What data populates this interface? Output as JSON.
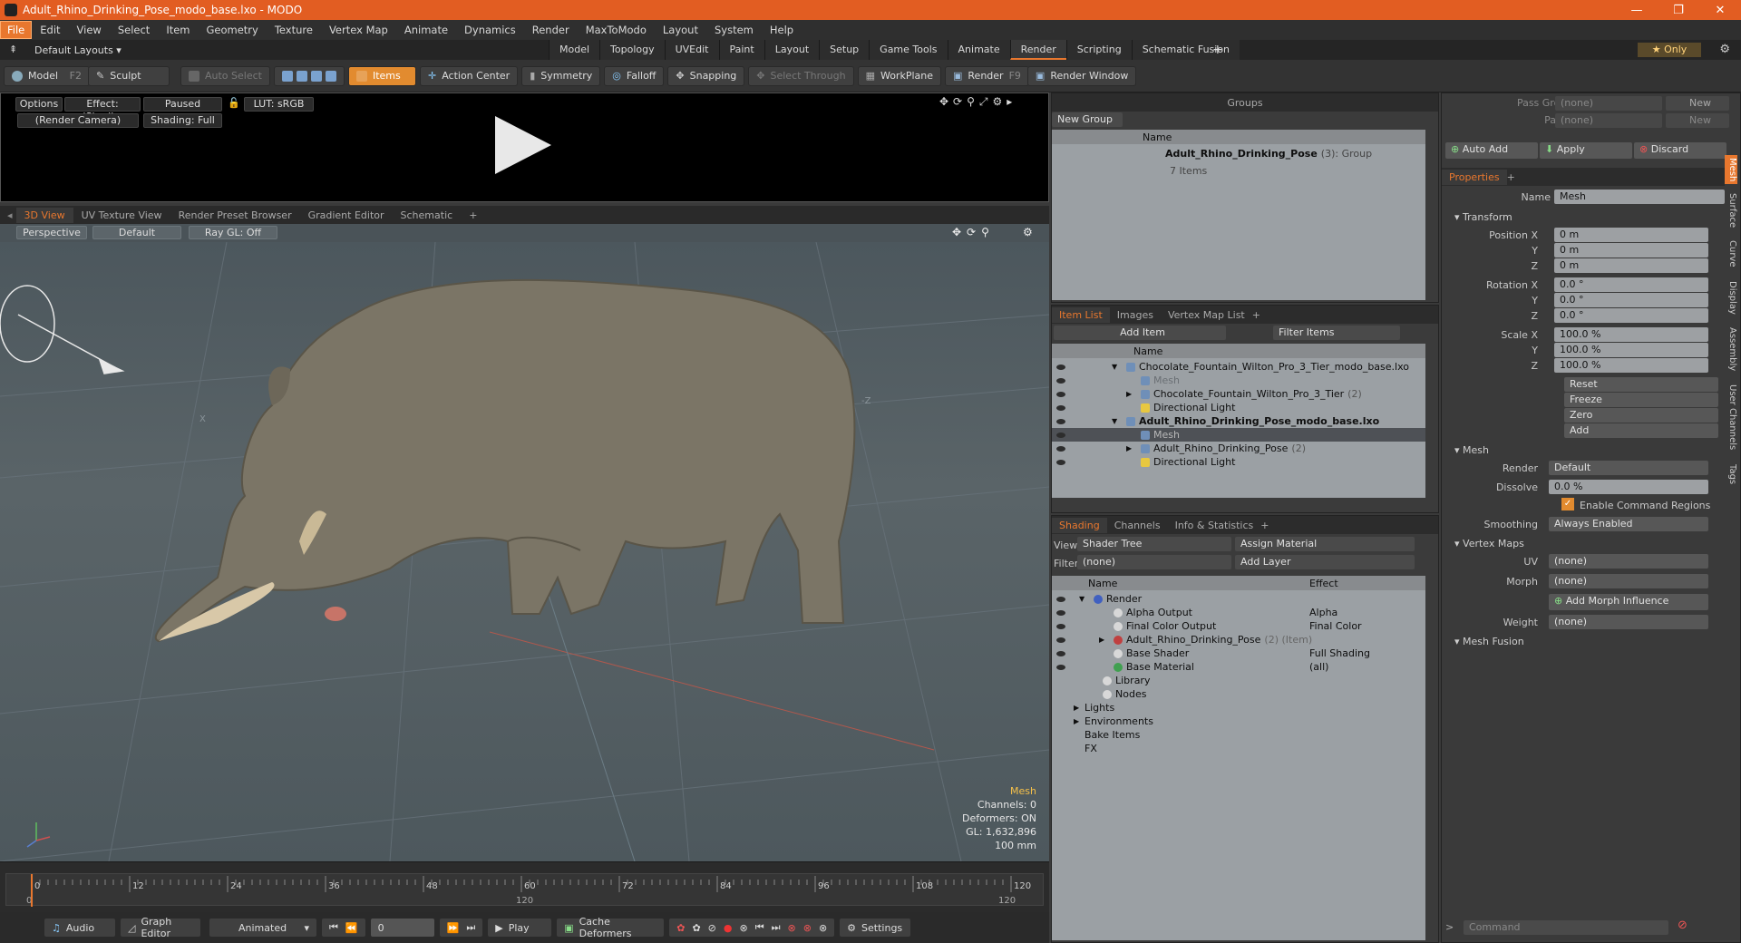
{
  "window": {
    "title": "Adult_Rhino_Drinking_Pose_modo_base.lxo - MODO",
    "min": "—",
    "max": "❐",
    "close": "✕"
  },
  "menu": [
    "File",
    "Edit",
    "View",
    "Select",
    "Item",
    "Geometry",
    "Texture",
    "Vertex Map",
    "Animate",
    "Dynamics",
    "Render",
    "MaxToModo",
    "Layout",
    "System",
    "Help"
  ],
  "layouts": {
    "default": "Default Layouts ▾",
    "tabs": [
      "Model",
      "Topology",
      "UVEdit",
      "Paint",
      "Layout",
      "Setup",
      "Game Tools",
      "Animate",
      "Render",
      "Scripting",
      "Schematic Fusion"
    ],
    "active": "Render",
    "add": "+",
    "only": "★  Only"
  },
  "toolbar": {
    "model": "Model",
    "model_key": "F2",
    "sculpt": "Sculpt",
    "auto_select": "Auto Select",
    "items": "Items",
    "action_center": "Action Center",
    "symmetry": "Symmetry",
    "falloff": "Falloff",
    "snapping": "Snapping",
    "select_through": "Select Through",
    "workplane": "WorkPlane",
    "render": "Render",
    "render_key": "F9",
    "render_window": "Render Window"
  },
  "preview": {
    "options": "Options",
    "effect": "Effect: (Shadi...",
    "paused": "Paused",
    "lut": "LUT: sRGB",
    "camera": "(Render Camera)",
    "shading": "Shading: Full"
  },
  "viewtabs": {
    "tabs": [
      "3D View",
      "UV Texture View",
      "Render Preset Browser",
      "Gradient Editor",
      "Schematic"
    ],
    "add": "+"
  },
  "viewbar": {
    "perspective": "Perspective",
    "default": "Default",
    "raygl": "Ray GL: Off"
  },
  "viewport_info": {
    "type": "Mesh",
    "channels": "Channels: 0",
    "deformers": "Deformers: ON",
    "gl": "GL: 1,632,896",
    "scale": "100 mm",
    "axis_x": "X",
    "axis_z": "-Z"
  },
  "timeline": {
    "ticks_top": [
      "0",
      "12",
      "24",
      "36",
      "48",
      "60",
      "72",
      "84",
      "96",
      "108",
      "120"
    ],
    "ticks_bottom": [
      "0",
      "120",
      "120"
    ]
  },
  "bottombar": {
    "audio": "Audio",
    "graph": "Graph Editor",
    "animated": "Animated",
    "frame": "0",
    "play": "Play",
    "cache": "Cache Deformers",
    "settings": "Settings"
  },
  "groups": {
    "title": "Groups",
    "new_group": "New Group",
    "col_name": "Name",
    "item_name": "Adult_Rhino_Drinking_Pose",
    "item_count": "(3)",
    "item_type": ": Group",
    "item_sub": "7 Items"
  },
  "itemlist": {
    "tabs": [
      "Item List",
      "Images",
      "Vertex Map List"
    ],
    "add_item": "Add Item",
    "filter": "Filter Items",
    "col_name": "Name",
    "rows": [
      {
        "label": "Chocolate_Fountain_Wilton_Pro_3_Tier_modo_base.lxo",
        "indent": 0,
        "bold": false,
        "arrow": "▼"
      },
      {
        "label": "Mesh",
        "indent": 1,
        "dim": true
      },
      {
        "label": "Chocolate_Fountain_Wilton_Pro_3_Tier",
        "suffix": "(2)",
        "indent": 1,
        "arrow": "▶"
      },
      {
        "label": "Directional Light",
        "indent": 1
      },
      {
        "label": "Adult_Rhino_Drinking_Pose_modo_base.lxo",
        "indent": 0,
        "bold": true,
        "arrow": "▼"
      },
      {
        "label": "Mesh",
        "indent": 1,
        "sel": true
      },
      {
        "label": "Adult_Rhino_Drinking_Pose",
        "suffix": "(2)",
        "indent": 1,
        "arrow": "▶"
      },
      {
        "label": "Directional Light",
        "indent": 1
      }
    ]
  },
  "shading": {
    "tabs": [
      "Shading",
      "Channels",
      "Info & Statistics"
    ],
    "view_label": "View",
    "view_value": "Shader Tree",
    "assign": "Assign Material",
    "filter_label": "Filter",
    "filter_value": "(none)",
    "add_layer": "Add Layer",
    "col_name": "Name",
    "col_effect": "Effect",
    "rows": [
      {
        "label": "Render",
        "effect": "",
        "indent": 0
      },
      {
        "label": "Alpha Output",
        "effect": "Alpha",
        "indent": 1
      },
      {
        "label": "Final Color Output",
        "effect": "Final Color",
        "indent": 1
      },
      {
        "label": "Adult_Rhino_Drinking_Pose",
        "suffix": "(2) (Item)",
        "effect": "",
        "indent": 1
      },
      {
        "label": "Base Shader",
        "effect": "Full Shading",
        "indent": 1
      },
      {
        "label": "Base Material",
        "effect": "(all)",
        "indent": 1
      },
      {
        "label": "Library",
        "effect": "",
        "indent": 0
      },
      {
        "label": "Nodes",
        "effect": "",
        "indent": 0
      },
      {
        "label": "Lights",
        "effect": "",
        "indent": -1
      },
      {
        "label": "Environments",
        "effect": "",
        "indent": -1
      },
      {
        "label": "Bake Items",
        "effect": "",
        "indent": -1
      },
      {
        "label": "FX",
        "effect": "",
        "indent": -1
      }
    ]
  },
  "props": {
    "pass_groups": "Pass Groups",
    "passes": "Passes",
    "none": "(none)",
    "new": "New",
    "auto_add": "Auto Add",
    "apply": "Apply",
    "discard": "Discard",
    "tab": "Properties",
    "name_label": "Name",
    "name_value": "Mesh",
    "transform": "Transform",
    "position_label": "Position X",
    "rotation_label": "Rotation X",
    "scale_label": "Scale X",
    "y": "Y",
    "z": "Z",
    "pos": [
      "0 m",
      "0 m",
      "0 m"
    ],
    "rot": [
      "0.0 °",
      "0.0 °",
      "0.0 °"
    ],
    "scl": [
      "100.0 %",
      "100.0 %",
      "100.0 %"
    ],
    "reset": "Reset",
    "freeze": "Freeze",
    "zero": "Zero",
    "add": "Add",
    "mesh": "Mesh",
    "render_label": "Render",
    "render_value": "Default",
    "dissolve_label": "Dissolve",
    "dissolve_value": "0.0 %",
    "enable_cmd": "Enable Command Regions",
    "smoothing_label": "Smoothing",
    "smoothing_value": "Always Enabled",
    "vertex_maps": "Vertex Maps",
    "uv_label": "UV",
    "morph_label": "Morph",
    "add_morph": "Add Morph Influence",
    "weight_label": "Weight",
    "mesh_fusion": "Mesh Fusion",
    "side_tabs": [
      "Mesh",
      "Surface",
      "Curve",
      "Display",
      "Assembly",
      "User Channels",
      "Tags"
    ],
    "command": "Command"
  },
  "colors": {
    "accent": "#e8772e",
    "title": "#e25d22"
  }
}
